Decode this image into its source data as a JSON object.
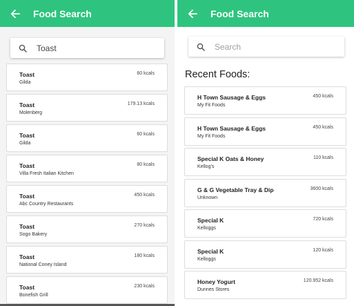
{
  "left_screen": {
    "title": "Food Search",
    "search_value": "Toast",
    "results": [
      {
        "name": "Toast",
        "source": "Gilda",
        "kcal": "60 kcals"
      },
      {
        "name": "Toast",
        "source": "Molenberg",
        "kcal": "179.13 kcals"
      },
      {
        "name": "Toast",
        "source": "Gilda",
        "kcal": "60 kcals"
      },
      {
        "name": "Toast",
        "source": "Villa Fresh Italian Kitchen",
        "kcal": "80 kcals"
      },
      {
        "name": "Toast",
        "source": "Abc Country Restaurants",
        "kcal": "450 kcals"
      },
      {
        "name": "Toast",
        "source": "Sogo Bakery",
        "kcal": "270 kcals"
      },
      {
        "name": "Toast",
        "source": "National Coney Island",
        "kcal": "180 kcals"
      },
      {
        "name": "Toast",
        "source": "Bonefish Grill",
        "kcal": "230 kcals"
      }
    ]
  },
  "right_screen": {
    "title": "Food Search",
    "search_placeholder": "Search",
    "recent_label": "Recent Foods:",
    "recent": [
      {
        "name": "H Town Sausage & Eggs",
        "source": "My Fit Foods",
        "kcal": "450 kcals"
      },
      {
        "name": "H Town Sausage & Eggs",
        "source": "My Fit Foods",
        "kcal": "450 kcals"
      },
      {
        "name": "Special K Oats & Honey",
        "source": "Kellog's",
        "kcal": "110 kcals"
      },
      {
        "name": "G & G Vegetable Tray & Dip",
        "source": "Unknown",
        "kcal": "3600 kcals"
      },
      {
        "name": "Special K",
        "source": "Kelloggs",
        "kcal": "720 kcals"
      },
      {
        "name": "Special K",
        "source": "Kelloggs",
        "kcal": "120 kcals"
      },
      {
        "name": "Honey Yogurt",
        "source": "Dunnes Stores",
        "kcal": "120.952 kcals"
      }
    ]
  },
  "icons": {
    "back": "arrow-left-icon",
    "search": "search-icon"
  },
  "colors": {
    "appbar": "#2ec47f",
    "appbar_text": "#ffffff"
  }
}
